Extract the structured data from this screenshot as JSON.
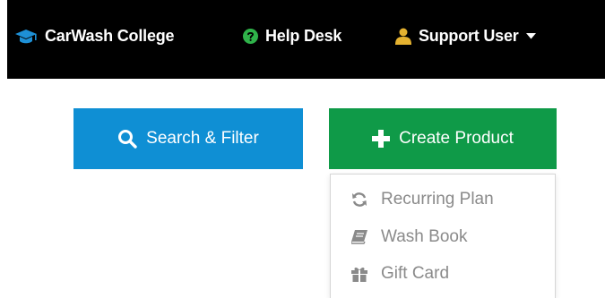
{
  "colors": {
    "topbar": "#000000",
    "brand_icon": "#1e90d6",
    "help_icon": "#2fb34a",
    "user_icon": "#e5b230",
    "search_button": "#0f8fd4",
    "create_button": "#0f9a48",
    "menu_text": "#8a8a8a"
  },
  "topbar": {
    "brand": {
      "label": "CarWash College",
      "icon": "graduation-cap-icon"
    },
    "help": {
      "label": "Help Desk",
      "icon": "question-circle-icon"
    },
    "user": {
      "label": "Support User",
      "icon": "user-icon",
      "caret": "caret-down-icon"
    }
  },
  "actions": {
    "search": {
      "label": "Search & Filter",
      "icon": "search-icon"
    },
    "create": {
      "label": "Create Product",
      "icon": "plus-icon"
    }
  },
  "create_menu": {
    "items": [
      {
        "label": "Recurring Plan",
        "icon": "refresh-icon"
      },
      {
        "label": "Wash Book",
        "icon": "book-icon"
      },
      {
        "label": "Gift Card",
        "icon": "gift-icon"
      }
    ]
  }
}
